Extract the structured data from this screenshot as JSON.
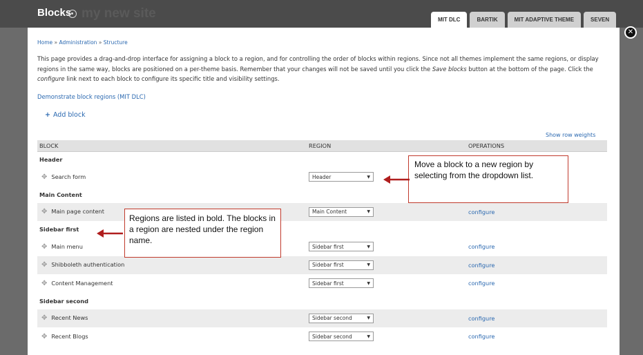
{
  "overlay": {
    "title": "Blocks",
    "ghost_site_name": "my new site",
    "close_label": "✕"
  },
  "tabs": [
    {
      "label": "MIT DLC",
      "active": true
    },
    {
      "label": "BARTIK",
      "active": false
    },
    {
      "label": "MIT ADAPTIVE THEME",
      "active": false
    },
    {
      "label": "SEVEN",
      "active": false
    }
  ],
  "breadcrumb": [
    "Home",
    "Administration",
    "Structure"
  ],
  "breadcrumb_sep": "»",
  "intro": {
    "part1": "This page provides a drag-and-drop interface for assigning a block to a region, and for controlling the order of blocks within regions. Since not all themes implement the same regions, or display regions in the same way, blocks are positioned on a per-theme basis. Remember that your changes will not be saved until you click the ",
    "save_blocks": "Save blocks",
    "part2": " button at the bottom of the page. Click the ",
    "configure": "configure",
    "part3": " link next to each block to configure its specific title and visibility settings."
  },
  "demo_link": "Demonstrate block regions (MIT DLC)",
  "add_block": {
    "icon": "+",
    "label": "Add block"
  },
  "show_row_weights": "Show row weights",
  "table": {
    "headers": [
      "BLOCK",
      "REGION",
      "OPERATIONS"
    ],
    "region_header": "Header",
    "region_main": "Main Content",
    "region_sidebar_first": "Sidebar first",
    "region_sidebar_second": "Sidebar second",
    "rows": [
      {
        "name": "Search form",
        "region": "Header",
        "op": ""
      },
      {
        "name": "Main page content",
        "region": "Main Content",
        "op": "configure"
      },
      {
        "name": "Main menu",
        "region": "Sidebar first",
        "op": "configure"
      },
      {
        "name": "Shibboleth authentication",
        "region": "Sidebar first",
        "op": "configure"
      },
      {
        "name": "Content Management",
        "region": "Sidebar first",
        "op": "configure"
      },
      {
        "name": "Recent News",
        "region": "Sidebar second",
        "op": "configure"
      },
      {
        "name": "Recent Blogs",
        "region": "Sidebar second",
        "op": "configure"
      }
    ],
    "drag_icon": "✥",
    "select_arrow": "▼"
  },
  "callouts": {
    "move_block": "Move a block to a new region by selecting from the dropdown list.",
    "regions_bold": "Regions are listed in bold. The blocks in a region are nested under the region name."
  },
  "colors": {
    "link": "#2a68b0",
    "callout_border": "#c0392b",
    "arrow": "#b01e1e"
  }
}
